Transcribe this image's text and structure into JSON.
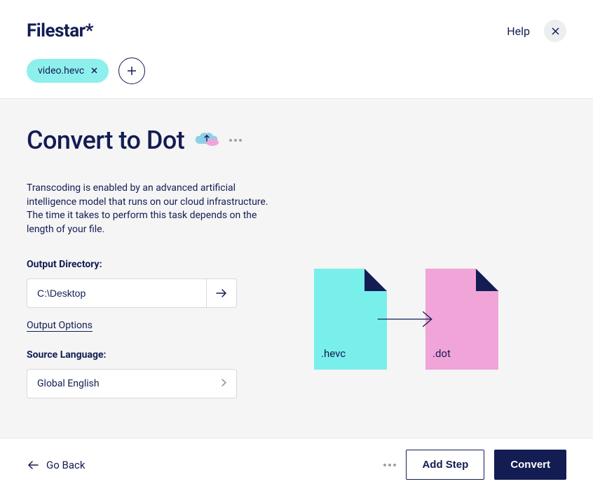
{
  "header": {
    "logo": "Filestar*",
    "help": "Help",
    "file_chip": "video.hevc"
  },
  "main": {
    "title": "Convert to Dot",
    "description": "Transcoding is enabled by an advanced artificial intelligence model that runs on our cloud infrastructure. The time it takes to perform this task depends on the length of your file.",
    "output_dir_label": "Output Directory:",
    "output_dir_value": "C:\\Desktop",
    "output_options": "Output Options",
    "source_lang_label": "Source Language:",
    "source_lang_value": "Global English",
    "diagram": {
      "from_ext": ".hevc",
      "to_ext": ".dot"
    }
  },
  "footer": {
    "go_back": "Go Back",
    "add_step": "Add Step",
    "convert": "Convert"
  }
}
